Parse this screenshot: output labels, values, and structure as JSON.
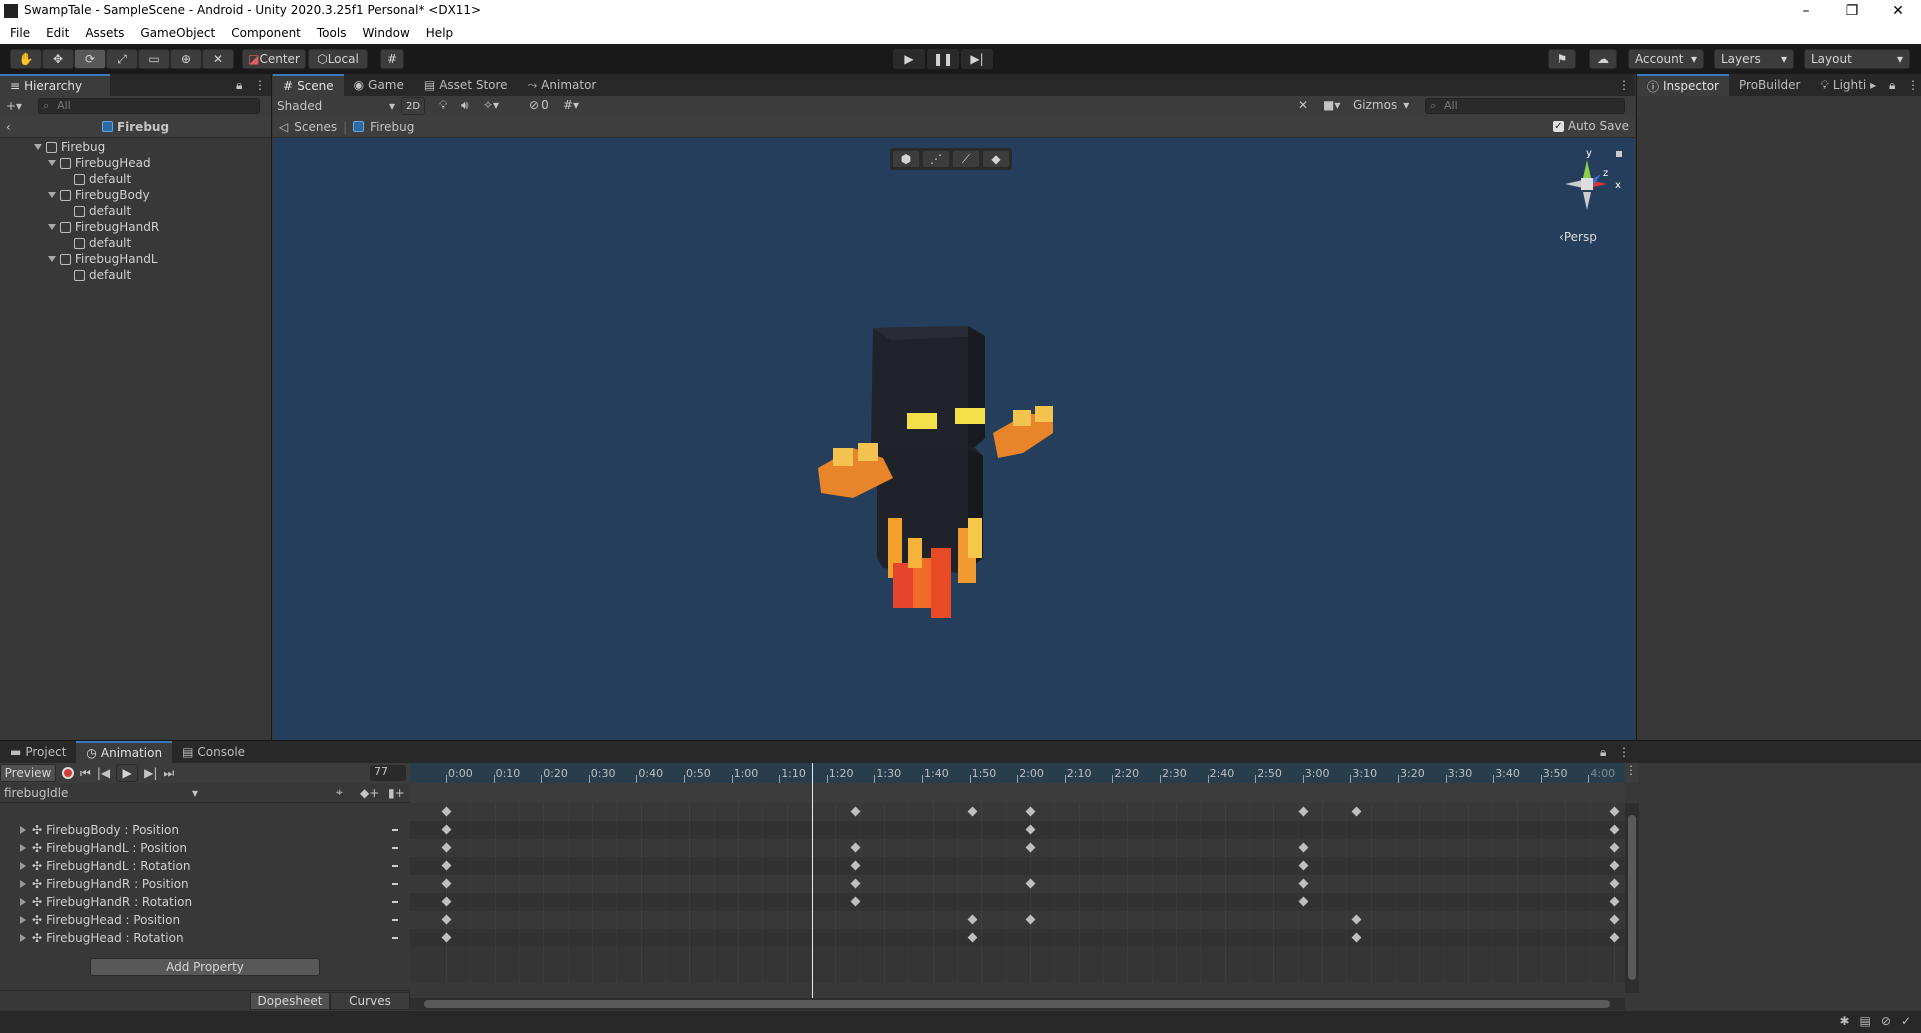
{
  "window": {
    "title": "SwampTale - SampleScene - Android - Unity 2020.3.25f1 Personal* <DX11>",
    "minimize": "–",
    "maximize": "❐",
    "close": "✕"
  },
  "menu": [
    "File",
    "Edit",
    "Assets",
    "GameObject",
    "Component",
    "Tools",
    "Window",
    "Help"
  ],
  "toolbar": {
    "pivot": "Center",
    "space": "Local",
    "account": "Account",
    "layers": "Layers",
    "layout": "Layout"
  },
  "hierarchy": {
    "tab": "Hierarchy",
    "search_placeholder": "All",
    "breadcrumb": "Firebug",
    "root": "Firebug",
    "children": [
      {
        "name": "FirebugHead",
        "child": "default"
      },
      {
        "name": "FirebugBody",
        "child": "default"
      },
      {
        "name": "FirebugHandR",
        "child": "default"
      },
      {
        "name": "FirebugHandL",
        "child": "default"
      }
    ]
  },
  "scene": {
    "tabs": [
      "Scene",
      "Game",
      "Asset Store",
      "Animator"
    ],
    "shading": "Shaded",
    "mode_2d": "2D",
    "hidden_count": "0",
    "gizmos": "Gizmos",
    "search_placeholder": "All",
    "breadcrumb_root": "Scenes",
    "breadcrumb_item": "Firebug",
    "auto_save": "Auto Save",
    "projection": "Persp",
    "axis_y": "y",
    "axis_z": "z",
    "axis_x": "x"
  },
  "inspector": {
    "tabs": [
      "Inspector",
      "ProBuilder",
      "Lighti"
    ]
  },
  "animation": {
    "tabs": [
      "Project",
      "Animation",
      "Console"
    ],
    "preview": "Preview",
    "frame": "77",
    "clip": "firebugIdle",
    "properties": [
      "FirebugBody : Position",
      "FirebugHandL : Position",
      "FirebugHandL : Rotation",
      "FirebugHandR : Position",
      "FirebugHandR : Rotation",
      "FirebugHead : Position",
      "FirebugHead : Rotation"
    ],
    "add_property": "Add Property",
    "dopesheet": "Dopesheet",
    "curves": "Curves",
    "ruler": [
      "0:00",
      "0:10",
      "0:20",
      "0:30",
      "0:40",
      "0:50",
      "1:00",
      "1:10",
      "1:20",
      "1:30",
      "1:40",
      "1:50",
      "2:00",
      "2:10",
      "2:20",
      "2:30",
      "2:40",
      "2:50",
      "3:00",
      "3:10",
      "3:20",
      "3:30",
      "3:40",
      "3:50",
      "4:00"
    ],
    "playhead_frame": 77,
    "keyframes": {
      "summary": [
        0,
        84,
        108,
        120,
        176,
        187,
        240
      ],
      "rows": [
        [
          0,
          120,
          240
        ],
        [
          0,
          84,
          120,
          176,
          240
        ],
        [
          0,
          84,
          176,
          240
        ],
        [
          0,
          84,
          120,
          176,
          240
        ],
        [
          0,
          84,
          176,
          240
        ],
        [
          0,
          108,
          120,
          187,
          240
        ],
        [
          0,
          108,
          187,
          240
        ]
      ]
    }
  }
}
